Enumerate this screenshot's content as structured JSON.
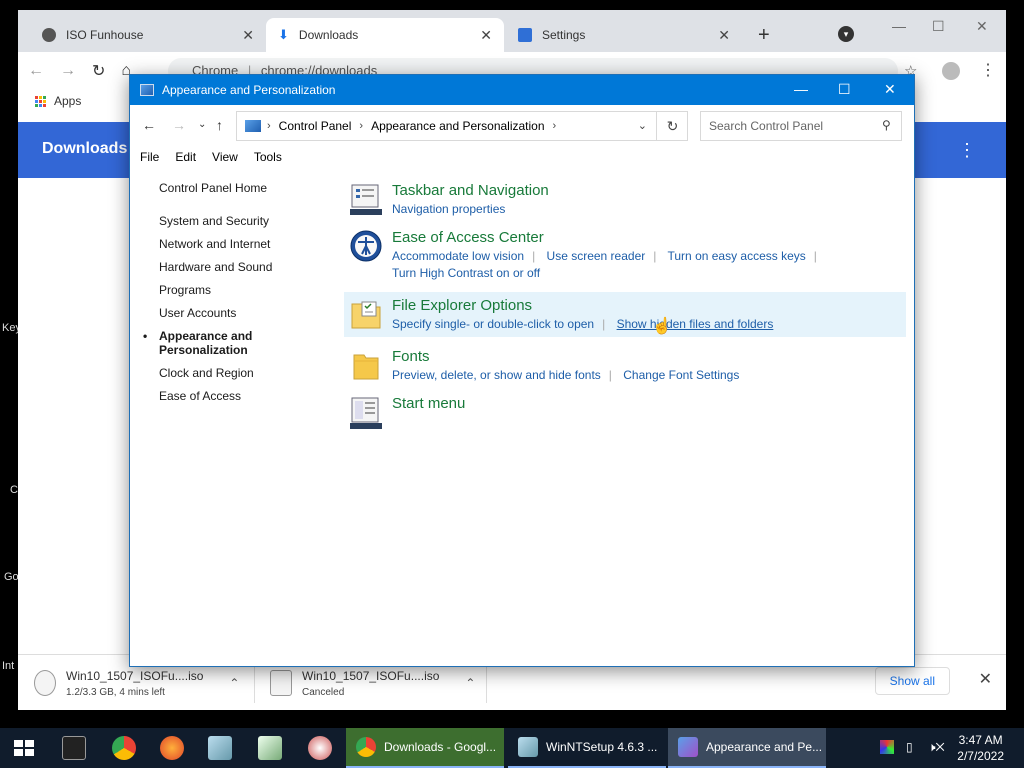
{
  "desktop": {
    "fragments": [
      "Key",
      "C",
      "Go",
      "Int"
    ]
  },
  "chrome": {
    "tabs": [
      {
        "label": "ISO Funhouse",
        "close": "✕"
      },
      {
        "label": "Downloads",
        "close": "✕"
      },
      {
        "label": "Settings",
        "close": "✕"
      }
    ],
    "new_tab": "+",
    "url": "chrome://downloads",
    "url_prefix": "Chrome",
    "bookmark_apps": "Apps",
    "page_title": "Downloads",
    "downloads": [
      {
        "name": "Win10_1507_ISOFu....iso",
        "status": "1.2/3.3 GB, 4 mins left"
      },
      {
        "name": "Win10_1507_ISOFu....iso",
        "status": "Canceled"
      }
    ],
    "show_all": "Show all",
    "colors": {
      "header": "#3367d6"
    }
  },
  "control_panel": {
    "title": "Appearance and Personalization",
    "breadcrumb": [
      "Control Panel",
      "Appearance and Personalization"
    ],
    "search_placeholder": "Search Control Panel",
    "menu": [
      "File",
      "Edit",
      "View",
      "Tools"
    ],
    "sidebar": {
      "home": "Control Panel Home",
      "items": [
        "System and Security",
        "Network and Internet",
        "Hardware and Sound",
        "Programs",
        "User Accounts",
        "Appearance and Personalization",
        "Clock and Region",
        "Ease of Access"
      ],
      "active_index": 5
    },
    "categories": [
      {
        "title": "Taskbar and Navigation",
        "links": [
          "Navigation properties"
        ],
        "icon": "taskbar-icon"
      },
      {
        "title": "Ease of Access Center",
        "links": [
          "Accommodate low vision",
          "Use screen reader",
          "Turn on easy access keys",
          "Turn High Contrast on or off"
        ],
        "icon": "ease-of-access-icon"
      },
      {
        "title": "File Explorer Options",
        "links": [
          "Specify single- or double-click to open",
          "Show hidden files and folders"
        ],
        "icon": "file-explorer-options-icon"
      },
      {
        "title": "Fonts",
        "links": [
          "Preview, delete, or show and hide fonts",
          "Change Font Settings"
        ],
        "icon": "fonts-folder-icon"
      },
      {
        "title": "Start menu",
        "links": [],
        "icon": "start-menu-icon"
      }
    ]
  },
  "taskbar": {
    "tasks": [
      {
        "label": "Downloads - Googl..."
      },
      {
        "label": "WinNTSetup 4.6.3 ..."
      },
      {
        "label": "Appearance and Pe..."
      }
    ],
    "time": "3:47 AM",
    "date": "2/7/2022"
  }
}
